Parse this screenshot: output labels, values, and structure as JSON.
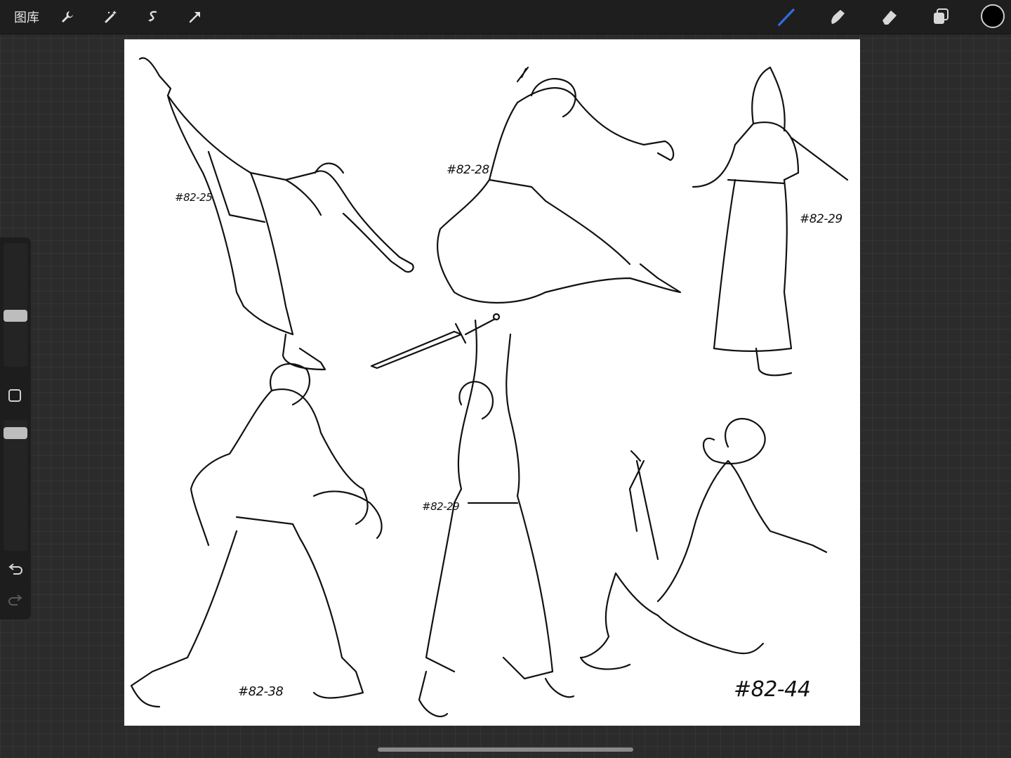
{
  "topbar": {
    "gallery_label": "图库",
    "left_tools": [
      "wrench-icon",
      "magic-wand-icon",
      "selection-icon",
      "transform-arrow-icon"
    ],
    "right_tools": [
      "brush-icon",
      "smudge-icon",
      "eraser-icon",
      "layers-icon"
    ],
    "accent_color": "#2f6fe0",
    "current_color": "#000000"
  },
  "sidebar": {
    "brush_size": 0.58,
    "opacity": 1.0,
    "undo_icon": "undo-icon",
    "redo_icon": "redo-icon"
  },
  "canvas": {
    "labels": {
      "fig1": "#82-25",
      "fig2": "#82-28",
      "fig3": "#82-29",
      "fig4": "#82-38",
      "fig5": "#82-29",
      "fig6": "#82-44"
    }
  }
}
